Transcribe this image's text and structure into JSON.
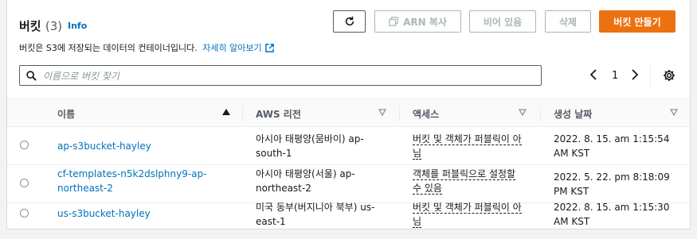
{
  "header": {
    "title": "버킷",
    "count": "(3)",
    "info": "Info",
    "description": "버킷은 S3에 저장되는 데이터의 컨테이너입니다.",
    "learn_more": "자세히 알아보기"
  },
  "toolbar": {
    "copy_arn": "ARN 복사",
    "empty": "비어 있음",
    "delete": "삭제",
    "create": "버킷 만들기"
  },
  "search": {
    "placeholder": "이름으로 버킷 찾기"
  },
  "pagination": {
    "page": "1"
  },
  "table": {
    "columns": [
      "이름",
      "AWS 리전",
      "액세스",
      "생성 날짜"
    ],
    "rows": [
      {
        "name": "ap-s3bucket-hayley",
        "region": "아시아 태평양(뭄바이) ap-south-1",
        "access": "버킷 및 객체가 퍼블릭이 아님",
        "created": "2022. 8. 15. am 1:15:54 AM KST"
      },
      {
        "name": "cf-templates-n5k2dslphny9-ap-northeast-2",
        "region": "아시아 태평양(서울) ap-northeast-2",
        "access": "객체를 퍼블릭으로 설정할 수 있음",
        "created": "2022. 5. 22. pm 8:18:09 PM KST"
      },
      {
        "name": "us-s3bucket-hayley",
        "region": "미국 동부(버지니아 북부) us-east-1",
        "access": "버킷 및 객체가 퍼블릭이 아님",
        "created": "2022. 8. 15. am 1:15:30 AM KST"
      }
    ]
  },
  "colors": {
    "primary": "#ec7211",
    "link": "#0073bb"
  },
  "icons": [
    "refresh-icon",
    "copy-icon",
    "external-link-icon",
    "search-icon",
    "chevron-left-icon",
    "chevron-right-icon",
    "gear-icon",
    "sort-up-icon",
    "sort-down-icon"
  ]
}
